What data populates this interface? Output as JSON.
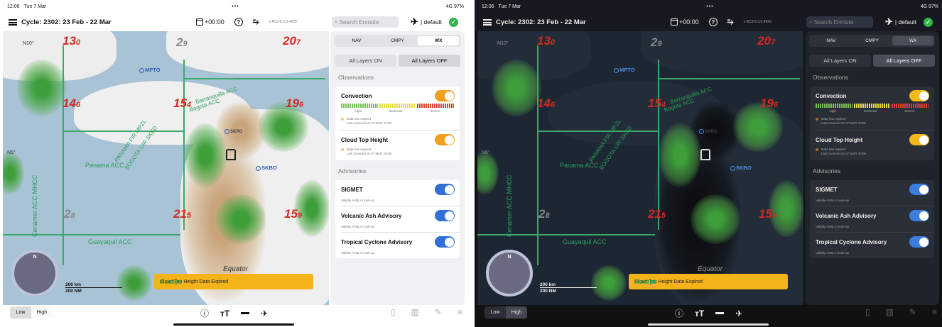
{
  "status": {
    "time": "12:06",
    "date": "Tue 7 Mar",
    "dots": "•••",
    "right": "4G 97%"
  },
  "header": {
    "cycle": "Cycle: 2302: 23 Feb - 22 Mar",
    "time_offset": "+00:00",
    "version": "v RC2-6.3.0.4929",
    "search_placeholder": "Search Enroute",
    "profile": "| default"
  },
  "panel": {
    "tabs": [
      "NAV",
      "CMPY",
      "WX"
    ],
    "selected_tab": "WX",
    "all_on": "All Layers ON",
    "all_off": "All Layers OFF",
    "observations_title": "Observations",
    "convection": {
      "title": "Convection",
      "enabled": true,
      "legend": [
        "Light",
        "Moderate",
        "Severe"
      ],
      "note1": "Data has expired",
      "note2": "Last received on 07 MAR 10:05"
    },
    "cloud_top": {
      "title": "Cloud Top Height",
      "enabled": true,
      "note1": "Data has expired",
      "note2": "Last received on 07 MAR 10:05"
    },
    "advisories_title": "Advisories",
    "advisories": [
      {
        "title": "SIGMET",
        "sub": "Validity AVBL in look-up",
        "enabled": true
      },
      {
        "title": "Volcanic Ash Advisory",
        "sub": "Validity AVBL in look-up",
        "enabled": true
      },
      {
        "title": "Tropical Cyclone Advisory",
        "sub": "Validity AVBL in look-up",
        "enabled": true
      }
    ]
  },
  "toast": {
    "message": "Cloud Top Height Data Expired",
    "action": "Accept"
  },
  "map": {
    "labels": [
      {
        "main": "13",
        "sub": "0"
      },
      {
        "main": "2",
        "sub": "9"
      },
      {
        "main": "20",
        "sub": "7"
      },
      {
        "main": "14",
        "sub": "6"
      },
      {
        "main": "15",
        "sub": "4"
      },
      {
        "main": "19",
        "sub": "6"
      },
      {
        "main": "2",
        "sub": "8"
      },
      {
        "main": "21",
        "sub": "5"
      },
      {
        "main": "15",
        "sub": "9"
      }
    ],
    "airports": [
      "MPTO",
      "SKBO",
      "SKRG"
    ],
    "regions": [
      "Panama ACC",
      "Guayaquil ACC",
      "Cenamer ACC MHCC",
      "Barranquilla ACC",
      "Bogota ACC",
      "PANAMA FIR MPZL",
      "BOGOTA UIR SKED"
    ],
    "lat_labels": [
      "N10°",
      "N5°"
    ],
    "equator": "Equator",
    "compass": "N",
    "scale_km": "200 km",
    "scale_nm": "200 NM"
  },
  "bottom": {
    "low": "Low",
    "high": "High"
  },
  "colors": {
    "accent": "#f0a020",
    "toggle_on_orange": "#f0a020",
    "toggle_on_blue": "#2f6fd6",
    "toast": "#f5b31a"
  }
}
